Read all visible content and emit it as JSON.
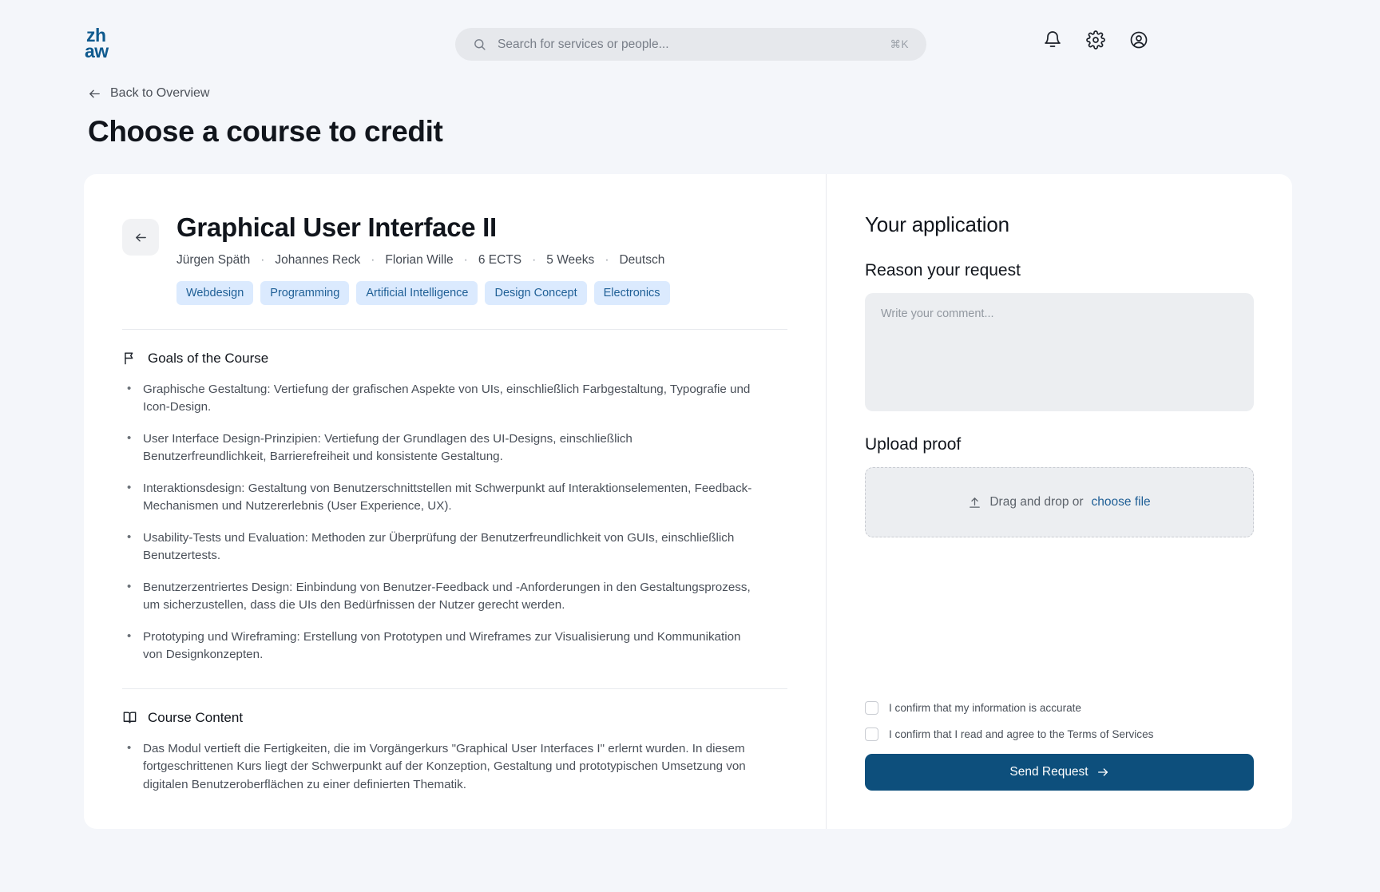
{
  "brand": {
    "logo_line1": "zh",
    "logo_line2": "aw",
    "color": "#0f5a8e"
  },
  "search": {
    "placeholder": "Search for services or people...",
    "shortcut": "⌘K",
    "icon": "search-icon"
  },
  "top_icons": [
    {
      "name": "notifications-icon",
      "label": "Notifications"
    },
    {
      "name": "settings-gear-icon",
      "label": "Settings"
    },
    {
      "name": "account-icon",
      "label": "Account"
    }
  ],
  "header": {
    "back_label": "Back to Overview",
    "title": "Choose a course to credit"
  },
  "course": {
    "title": "Graphical User Interface II",
    "meta": [
      "Jürgen Späth",
      "Johannes Reck",
      "Florian Wille",
      "6 ECTS",
      "5 Weeks",
      "Deutsch"
    ],
    "meta_separator": "·",
    "tags": [
      "Webdesign",
      "Programming",
      "Artificial Intelligence",
      "Design Concept",
      "Electronics"
    ],
    "goals": {
      "heading": "Goals of the Course",
      "icon": "flag-icon",
      "items": [
        "Graphische Gestaltung: Vertiefung der grafischen Aspekte von UIs, einschließlich Farbgestaltung, Typografie und Icon-Design.",
        "User Interface Design-Prinzipien: Vertiefung der Grundlagen des UI-Designs, einschließlich Benutzerfreundlichkeit, Barrierefreiheit und konsistente Gestaltung.",
        "Interaktionsdesign: Gestaltung von Benutzerschnittstellen mit Schwerpunkt auf Interaktionselementen, Feedback-Mechanismen und Nutzererlebnis (User Experience, UX).",
        "Usability-Tests und Evaluation: Methoden zur Überprüfung der Benutzerfreundlichkeit von GUIs, einschließlich Benutzertests.",
        "Benutzerzentriertes Design: Einbindung von Benutzer-Feedback und -Anforderungen in den Gestaltungsprozess, um sicherzustellen, dass die UIs den Bedürfnissen der Nutzer gerecht werden.",
        "Prototyping und Wireframing: Erstellung von Prototypen und Wireframes zur Visualisierung und Kommunikation von Designkonzepten."
      ]
    },
    "content": {
      "heading": "Course Content",
      "icon": "book-icon",
      "items": [
        "Das Modul vertieft die Fertigkeiten, die im Vorgängerkurs \"Graphical User Interfaces I\" erlernt wurden. In diesem fortgeschrittenen Kurs liegt der Schwerpunkt auf der Konzeption, Gestaltung und prototypischen Umsetzung von digitalen Benutzeroberflächen zu einer definierten Thematik."
      ]
    }
  },
  "application": {
    "title": "Your application",
    "reason_label": "Reason your request",
    "comment_placeholder": "Write your comment...",
    "comment_value": "",
    "upload_label": "Upload proof",
    "upload_text": "Drag and drop or",
    "upload_link": "choose file",
    "checkboxes": [
      {
        "label": "I confirm that my information is accurate",
        "checked": false
      },
      {
        "label": "I confirm that I read and agree to the Terms of Services",
        "checked": false
      }
    ],
    "submit_label": "Send Request",
    "submit_color": "#0d4f7c"
  }
}
